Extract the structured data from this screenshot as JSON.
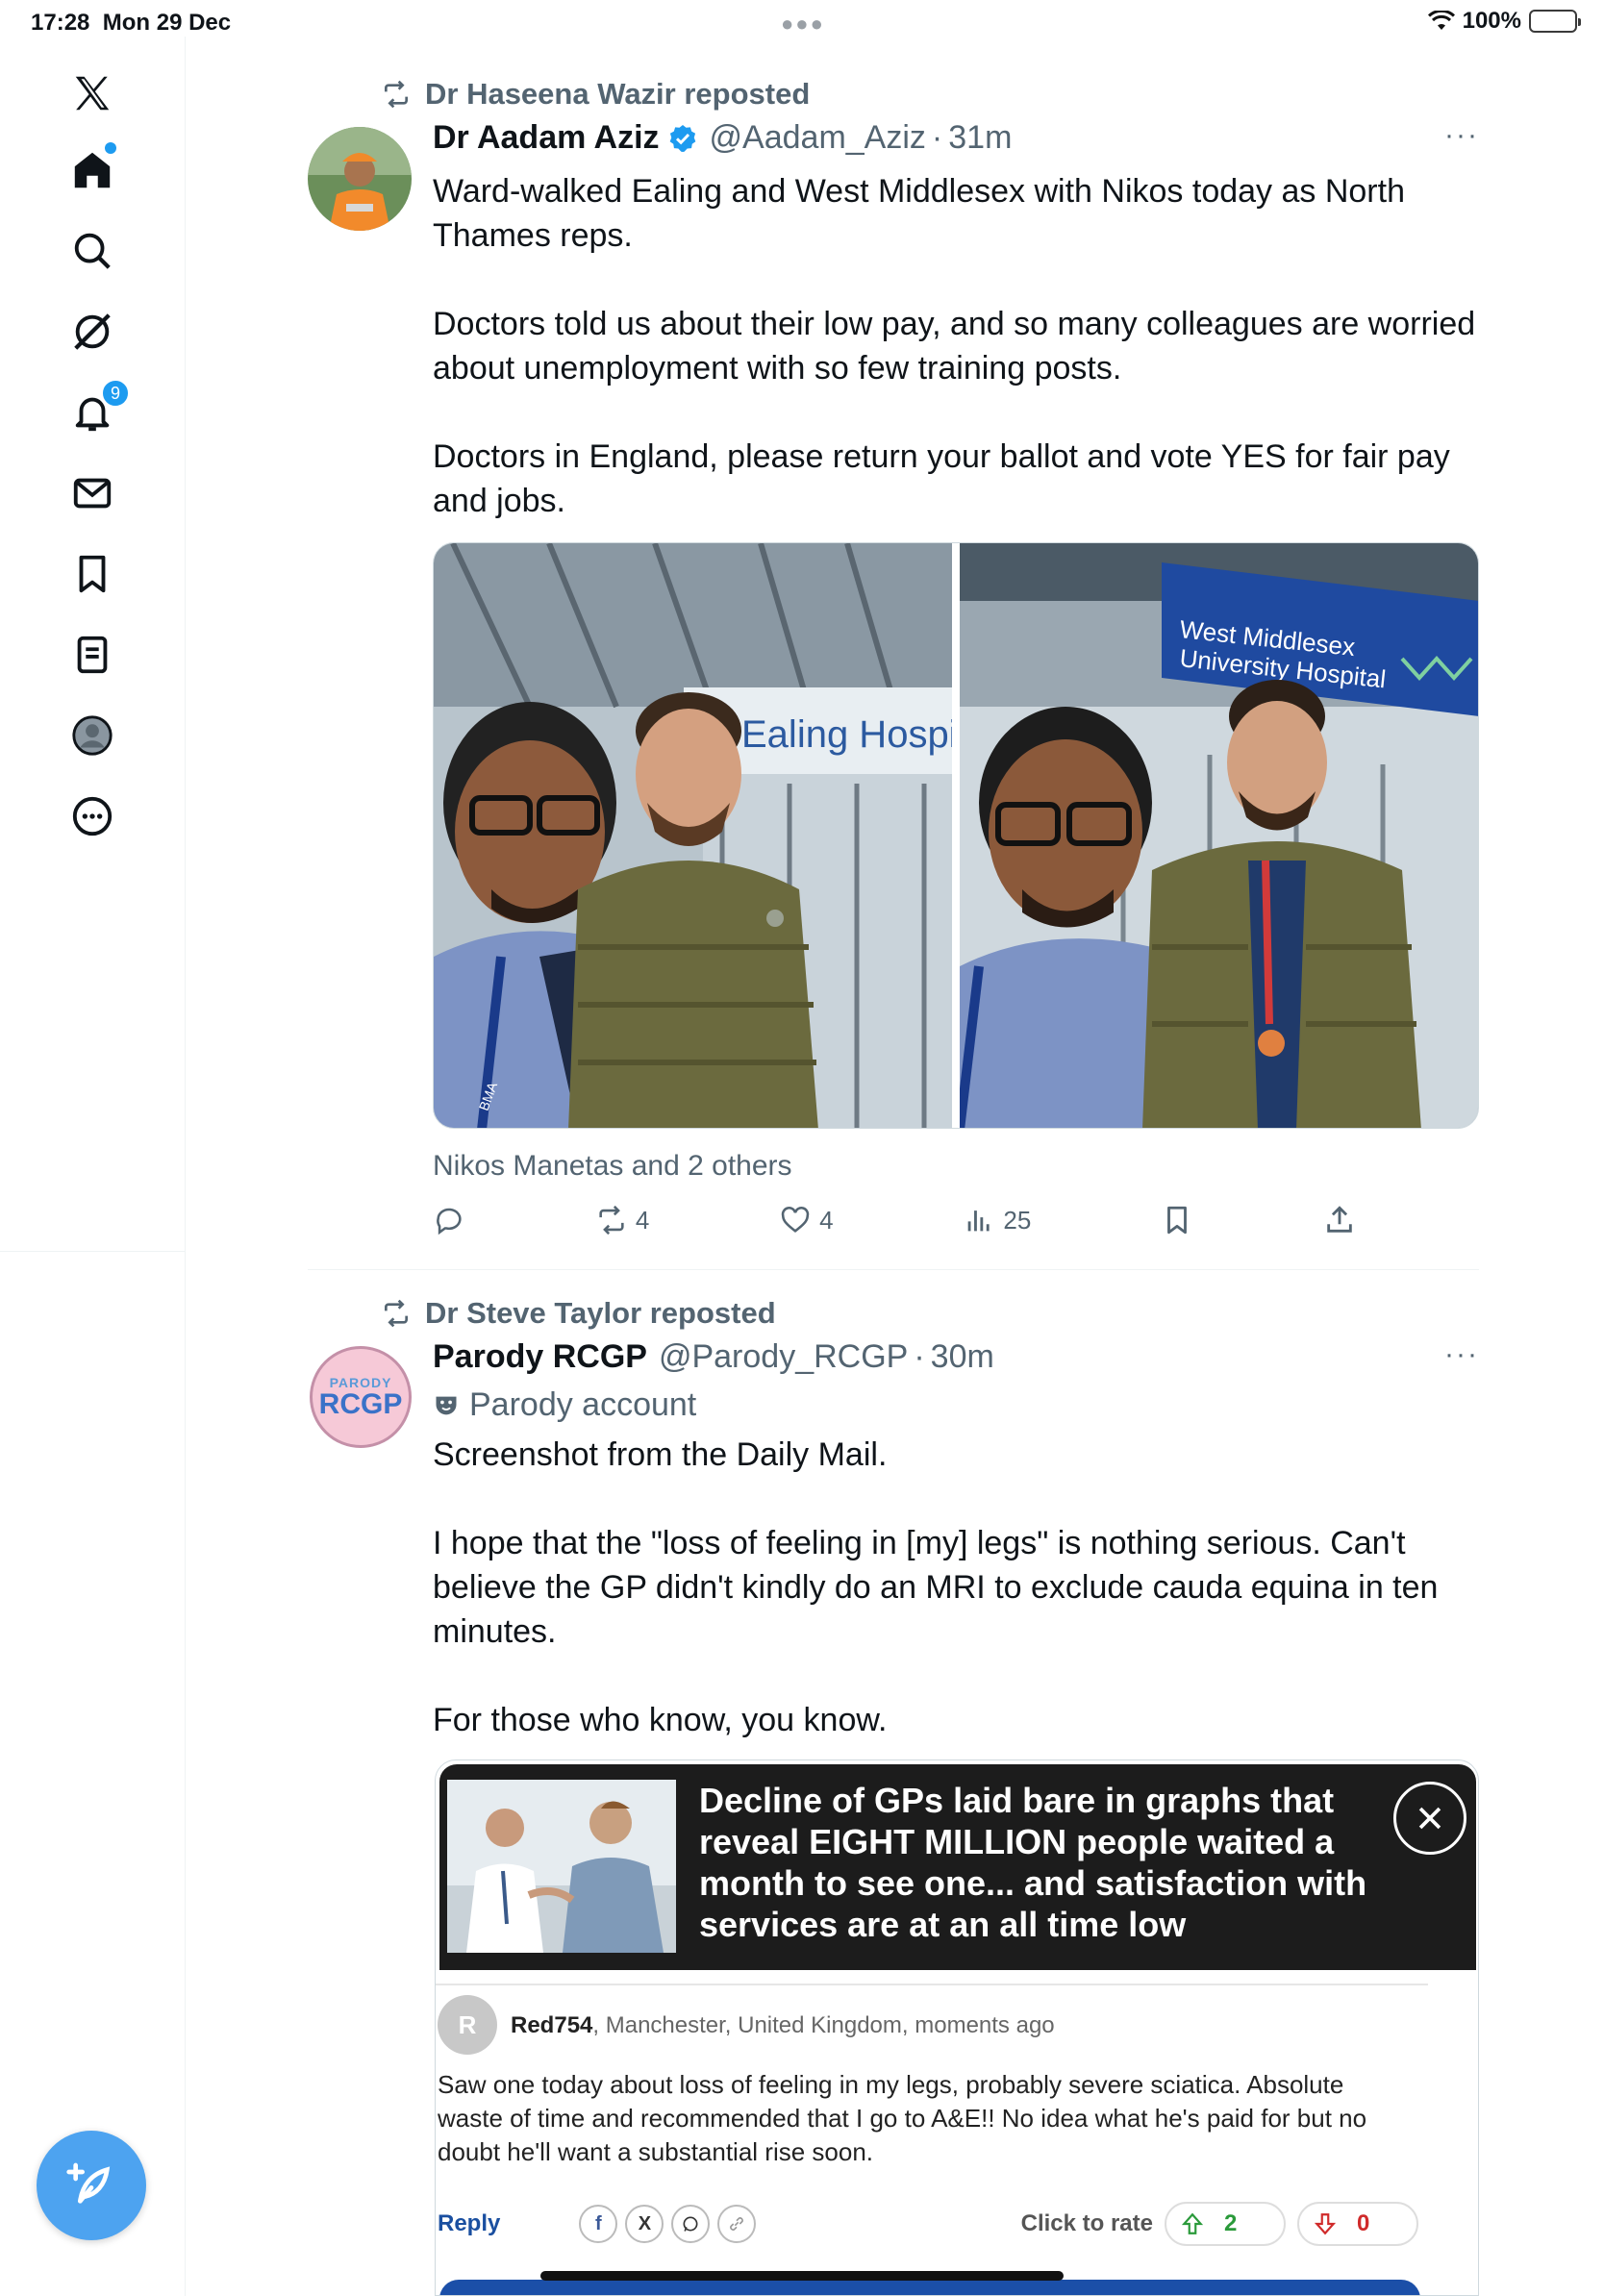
{
  "status_bar": {
    "time": "17:28",
    "date": "Mon 29 Dec",
    "battery": "100%"
  },
  "sidebar": {
    "notifications_count": "9"
  },
  "posts": [
    {
      "reposted_by": "Dr Haseena Wazir reposted",
      "name": "Dr Aadam Aziz",
      "handle": "@Aadam_Aziz",
      "separator": "·",
      "time": "31m",
      "more": "···",
      "text": "Ward-walked Ealing and West Middlesex with Nikos today as North Thames reps.\n\nDoctors told us about their low pay, and so many colleagues are worried about unemployment with so few training posts.\n\nDoctors in England, please return your ballot and vote YES for fair pay and jobs.",
      "photo_1_sign": "Ealing Hospita",
      "photo_2_sign_line1": "West Middlesex",
      "photo_2_sign_line2": "University Hospital",
      "lanyard_text": "BMA",
      "liked_by": "Nikos Manetas and 2 others",
      "reposts": "4",
      "likes": "4",
      "views": "25"
    },
    {
      "reposted_by": "Dr Steve Taylor reposted",
      "name": "Parody RCGP",
      "handle": "@Parody_RCGP",
      "separator": "·",
      "time": "30m",
      "more": "···",
      "parody_label": "Parody account",
      "avatar_small": "PARODY",
      "avatar_big": "RCGP",
      "text": "Screenshot from the Daily Mail.\n\nI hope that the \"loss of feeling in [my] legs\" is nothing serious. Can't believe the GP didn't kindly do an MRI to exclude cauda equina in ten minutes.\n\nFor those who know, you know.",
      "screenshot": {
        "headline": "Decline of GPs laid bare in graphs that reveal EIGHT MILLION people waited a month to see one... and satisfaction with services are at an all time low",
        "comment_avatar": "R",
        "comment_user": "Red754",
        "comment_meta": ", Manchester, United Kingdom, moments ago",
        "comment_text": "Saw one today about loss of feeling in my legs, probably severe sciatica. Absolute waste of time and recommended that I go to A&E!! No idea what he's paid for but no doubt he'll want a substantial rise soon.",
        "reply": "Reply",
        "share_f": "f",
        "share_x": "X",
        "click_to_rate": "Click to rate",
        "up_count": "2",
        "down_count": "0"
      }
    }
  ],
  "colors": {
    "accent": "#1d9bf0",
    "muted": "#536471",
    "text": "#0f1419"
  }
}
